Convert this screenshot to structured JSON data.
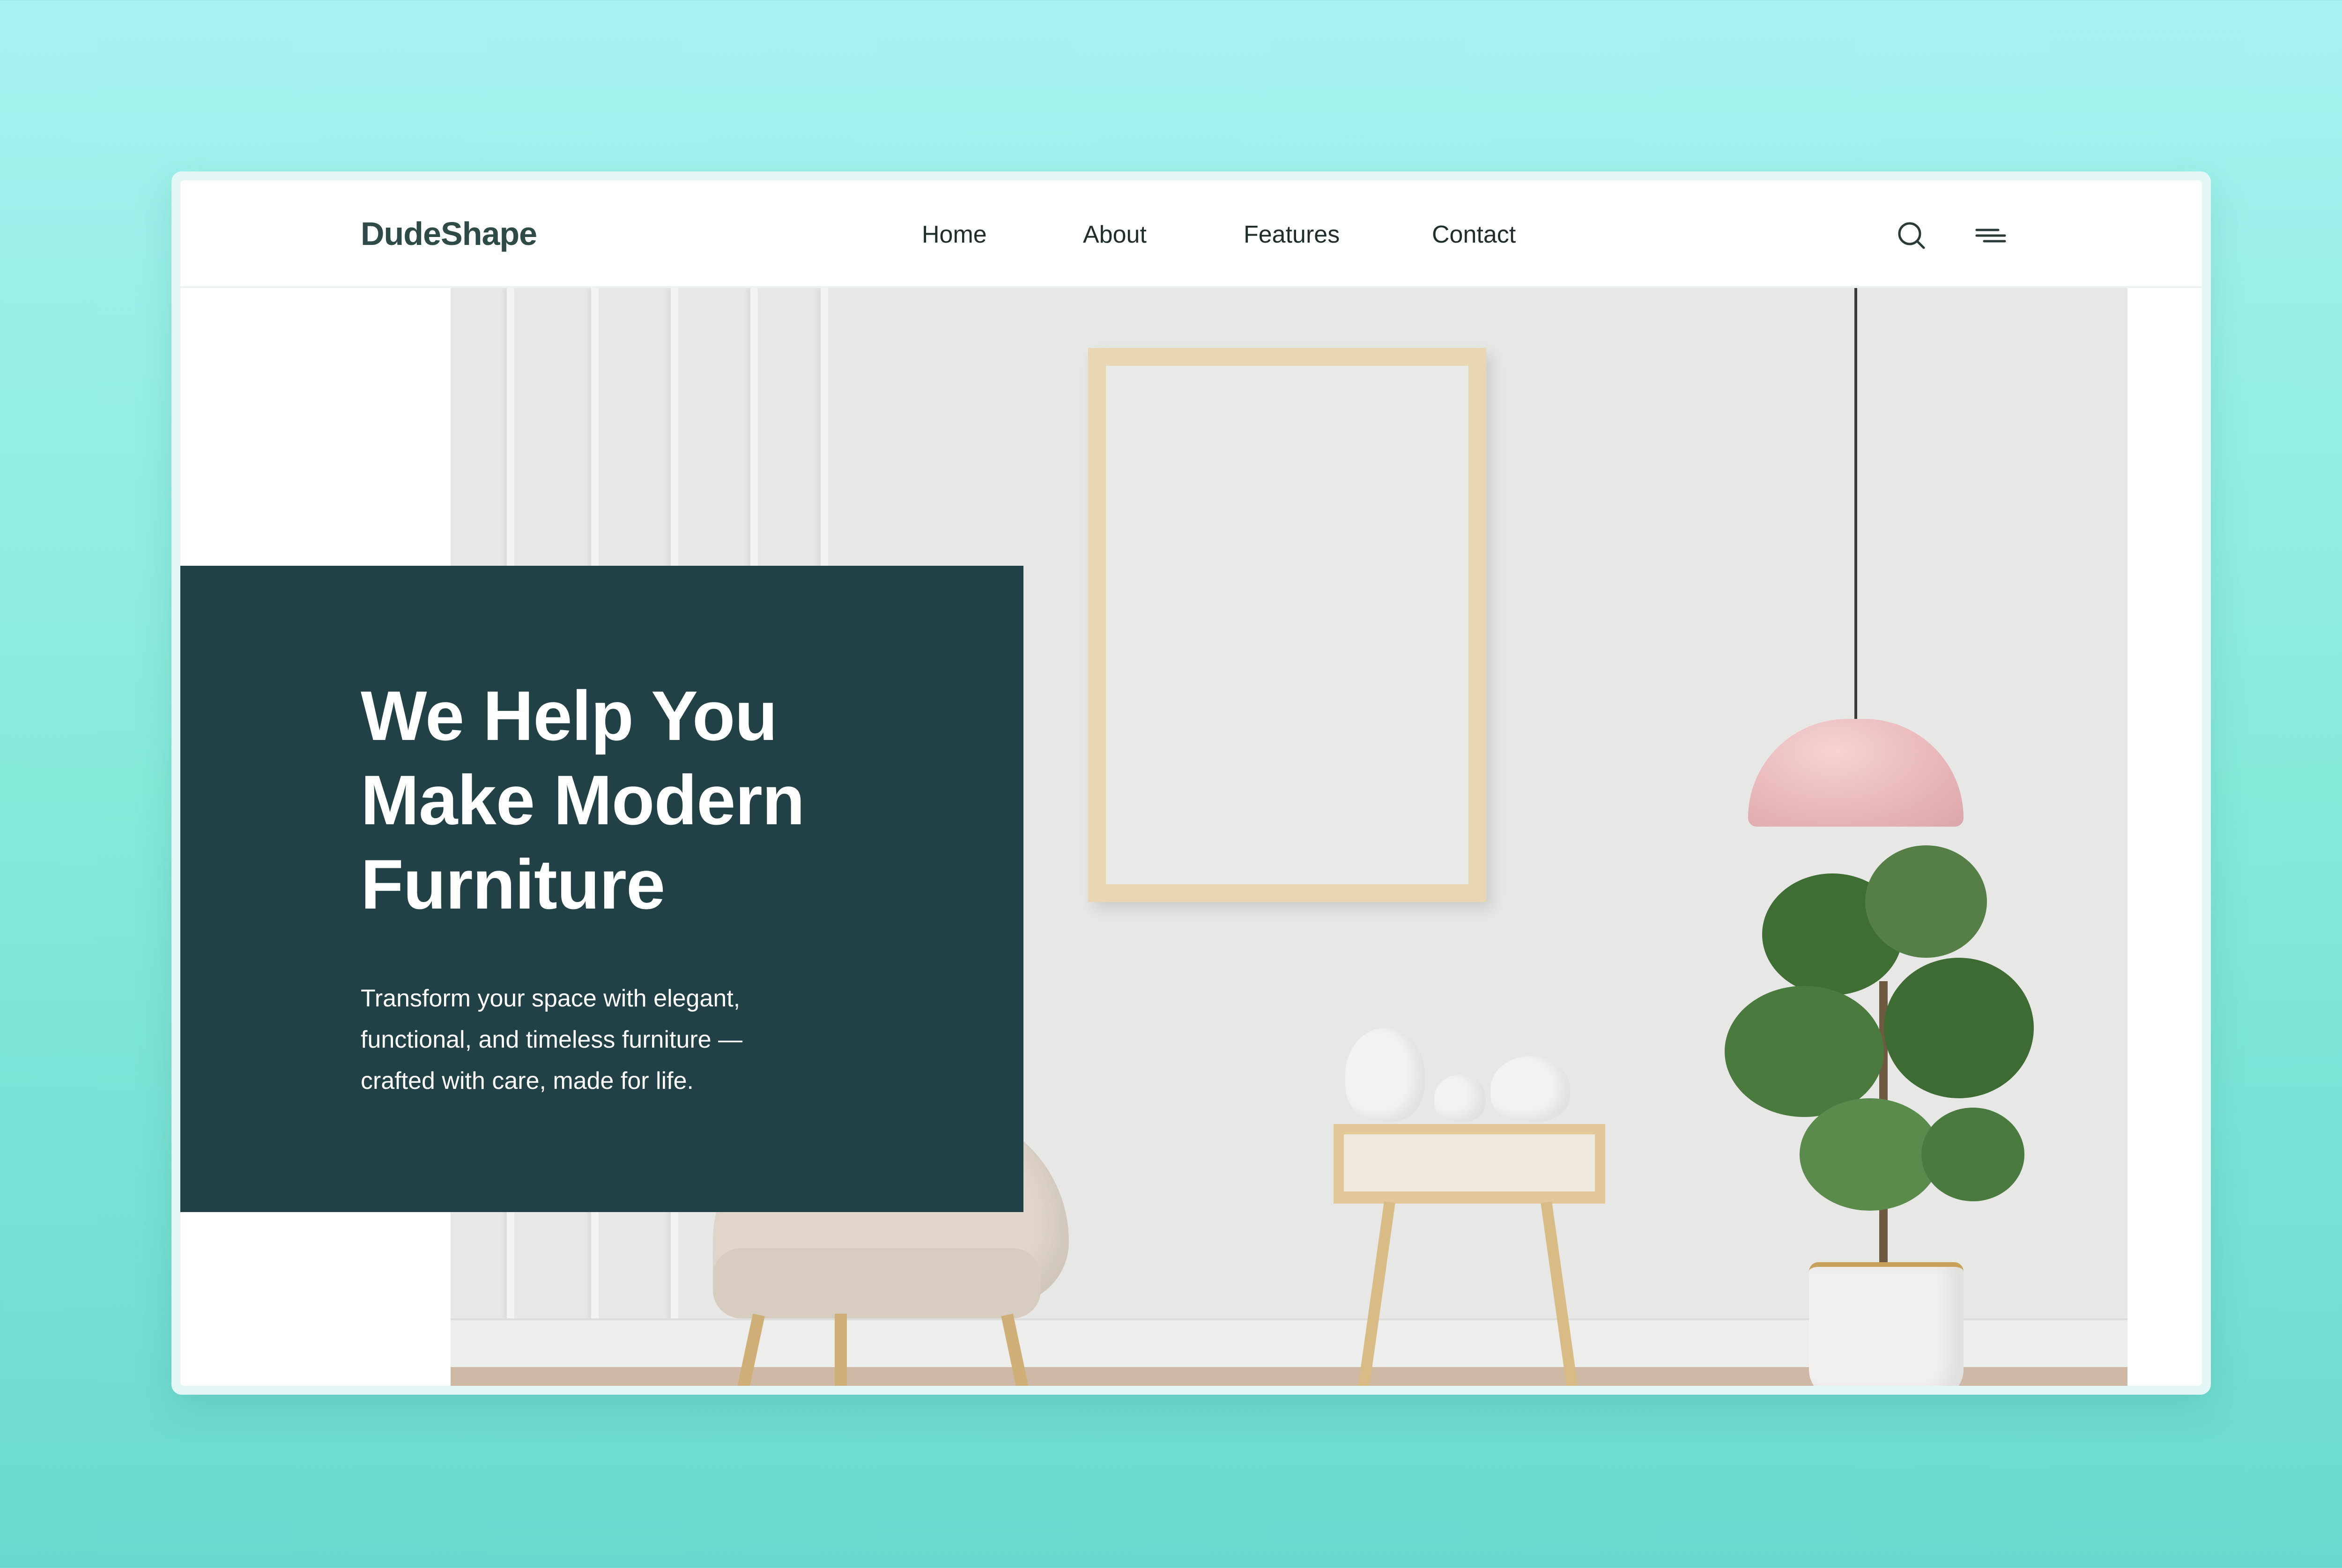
{
  "header": {
    "brand": "DudeShape",
    "nav": [
      {
        "label": "Home"
      },
      {
        "label": "About"
      },
      {
        "label": "Features"
      },
      {
        "label": "Contact"
      }
    ],
    "icons": {
      "search": "search-icon",
      "menu": "menu-icon"
    }
  },
  "hero": {
    "title_lines": [
      "We Help You",
      "Make Modern",
      "Furniture"
    ],
    "subtitle_lines": [
      "Transform your space with elegant,",
      "functional, and timeless furniture —",
      "crafted with care, made for life."
    ]
  },
  "colors": {
    "background_top": "#a6f3ef",
    "background_bottom": "#6bd9cf",
    "brand": "#2f4b47",
    "hero_card": "#224146",
    "lamp": "#e7b6b9",
    "frame": "#e9d6b3"
  }
}
